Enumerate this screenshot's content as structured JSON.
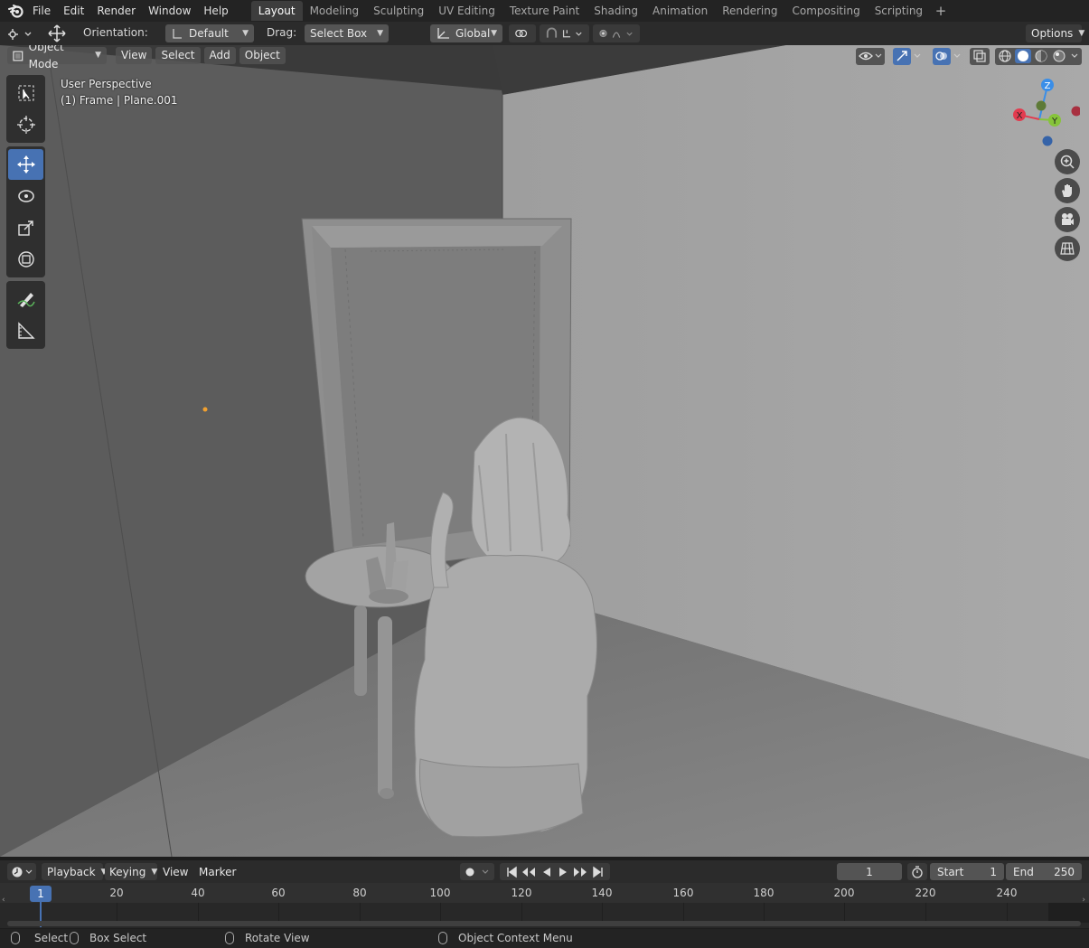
{
  "menubar": {
    "menus": [
      "File",
      "Edit",
      "Render",
      "Window",
      "Help"
    ],
    "workspaces": [
      "Layout",
      "Modeling",
      "Sculpting",
      "UV Editing",
      "Texture Paint",
      "Shading",
      "Animation",
      "Rendering",
      "Compositing",
      "Scripting"
    ],
    "active_workspace": "Layout",
    "add_tab": "+"
  },
  "tool_header": {
    "orientation_label": "Orientation:",
    "orientation_value": "Default",
    "drag_label": "Drag:",
    "drag_value": "Select Box",
    "transform_orientation": "Global",
    "options_label": "Options"
  },
  "viewport": {
    "mode": "Object Mode",
    "menus": [
      "View",
      "Select",
      "Add",
      "Object"
    ],
    "perspective": "User Perspective",
    "selection_info": "(1) Frame | Plane.001",
    "gizmo_axes": {
      "z": "Z",
      "x": "X",
      "y": "Y"
    },
    "colors": {
      "x_axis": "#e23b4f",
      "y_axis": "#86c43a",
      "z_axis": "#3a8ee8",
      "accent": "#4772b3"
    }
  },
  "timeline": {
    "menus": [
      "Playback",
      "Keying",
      "View",
      "Marker"
    ],
    "current_frame": "1",
    "start_label": "Start",
    "start_value": "1",
    "end_label": "End",
    "end_value": "250",
    "indicator": "1",
    "ticks": [
      "20",
      "40",
      "60",
      "80",
      "100",
      "120",
      "140",
      "160",
      "180",
      "200",
      "220",
      "240"
    ]
  },
  "statusbar": {
    "items": [
      "Select",
      "Box Select",
      "Rotate View",
      "Object Context Menu"
    ]
  }
}
